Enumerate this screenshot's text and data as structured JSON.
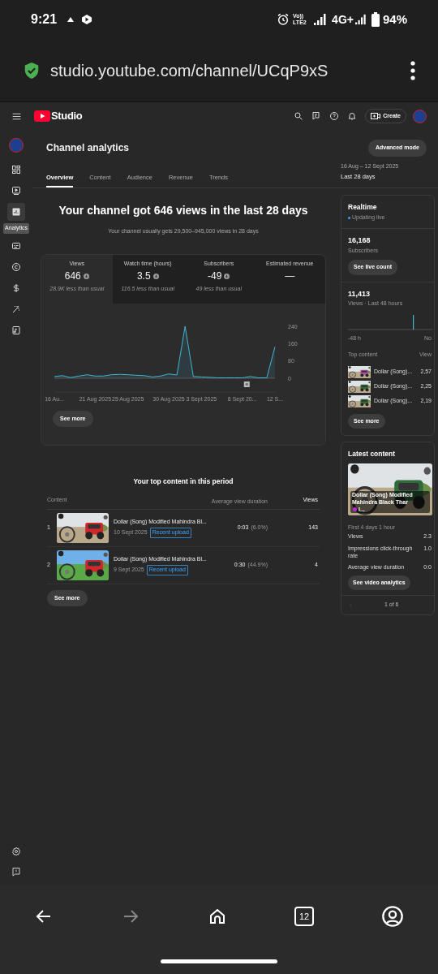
{
  "status_bar": {
    "time": "9:21",
    "network_label": "Vo)) LTE2",
    "network_type": "4G+",
    "battery": "94%"
  },
  "browser": {
    "url": "studio.youtube.com/channel/UCqP9xS"
  },
  "header": {
    "logo_text": "Studio",
    "create_label": "Create"
  },
  "sidebar": {
    "items": [
      {
        "kind": "dashboard",
        "selected": false
      },
      {
        "kind": "content",
        "selected": false
      },
      {
        "kind": "analytics",
        "selected": true,
        "tooltip": "Analytics"
      },
      {
        "kind": "subtitles",
        "selected": false
      },
      {
        "kind": "copyright",
        "selected": false
      },
      {
        "kind": "earn",
        "selected": false
      },
      {
        "kind": "customization",
        "selected": false
      },
      {
        "kind": "audio",
        "selected": false
      }
    ]
  },
  "page": {
    "title": "Channel analytics",
    "advanced_mode": "Advanced mode",
    "tabs": [
      {
        "label": "Overview",
        "selected": true
      },
      {
        "label": "Content",
        "selected": false
      },
      {
        "label": "Audience",
        "selected": false
      },
      {
        "label": "Revenue",
        "selected": false
      },
      {
        "label": "Trends",
        "selected": false
      }
    ],
    "date_range": {
      "range": "16 Aug – 12 Sept 2025",
      "label": "Last 28 days"
    }
  },
  "overview": {
    "headline": "Your channel got 646 views in the last 28 days",
    "subline": "Your channel usually gets 29,500–945,000 views in 28 days",
    "metrics": [
      {
        "label": "Views",
        "value": "646",
        "below_usual": true,
        "note": "28.9K less than usual",
        "selected": true
      },
      {
        "label": "Watch time (hours)",
        "value": "3.5",
        "below_usual": true,
        "note": "116.5 less than usual",
        "selected": false
      },
      {
        "label": "Subscribers",
        "value": "-49",
        "below_usual": true,
        "note": "49 less than usual",
        "selected": false
      },
      {
        "label": "Estimated revenue",
        "value": "—",
        "below_usual": false,
        "selected": false
      }
    ],
    "chart_data": {
      "type": "area",
      "categories": [
        "16 Au...",
        null,
        null,
        null,
        null,
        "21 Aug 2025",
        null,
        null,
        null,
        "25 Aug 2025",
        null,
        null,
        null,
        null,
        "30 Aug 2025",
        null,
        null,
        null,
        "3 Sept 2025",
        null,
        null,
        null,
        null,
        "8 Sept 20...",
        null,
        null,
        null,
        "12 S..."
      ],
      "series": [
        {
          "color": "#41b6d6",
          "values": [
            8,
            12,
            3,
            10,
            16,
            10,
            10,
            16,
            18,
            16,
            14,
            12,
            6,
            10,
            20,
            15,
            240,
            8,
            6,
            4,
            2,
            2,
            2,
            2,
            8,
            2,
            2,
            145
          ]
        }
      ],
      "ylim": [
        0,
        240
      ],
      "yticks": [
        0,
        80,
        160,
        240
      ]
    },
    "see_more": "See more"
  },
  "top_content": {
    "title": "Your top content in this period",
    "columns": [
      "Content",
      "Average view duration",
      "Views"
    ],
    "rows": [
      {
        "rank": "1",
        "title": "Dollar (Song) Modified Mahindra Bl...",
        "date": "10 Sept 2025",
        "badge": "Recent upload",
        "duration": "0:03",
        "percent": "(6.0%)",
        "views": "143"
      },
      {
        "rank": "2",
        "title": "Dollar (Song) Modified Mahindra Bl...",
        "date": "9 Sept 2025",
        "badge": "Recent upload",
        "duration": "0:30",
        "percent": "(44.9%)",
        "views": "4"
      }
    ],
    "see_more": "See more"
  },
  "realtime": {
    "title": "Realtime",
    "status": "Updating live",
    "subscribers": "16,168",
    "subscribers_label": "Subscribers",
    "live_count": "See live count",
    "views": "11,413",
    "views_label": "Views · Last 48 hours",
    "axis_start": "-48 h",
    "axis_end": "No",
    "top_content_label": "Top content",
    "views_column": "View",
    "rows": [
      {
        "title": "Dollar (Song)...",
        "views": "2,57"
      },
      {
        "title": "Dollar (Song)...",
        "views": "2,25"
      },
      {
        "title": "Dollar (Song)...",
        "views": "2,19"
      }
    ],
    "see_more": "See more"
  },
  "latest": {
    "title": "Latest content",
    "video_title": "Dollar (Song) Modified Mahindra Black Thar",
    "video_title_end": "I...",
    "period": "First 4 days 1 hour",
    "stats": [
      {
        "label": "Views",
        "value": "2.3"
      },
      {
        "label": "Impressions click-through rate",
        "value": "1.0"
      },
      {
        "label": "Average view duration",
        "value": "0:0"
      }
    ],
    "button": "See video analytics",
    "pager": "1 of 6"
  },
  "nav_bar": {
    "tab_count": "12"
  }
}
